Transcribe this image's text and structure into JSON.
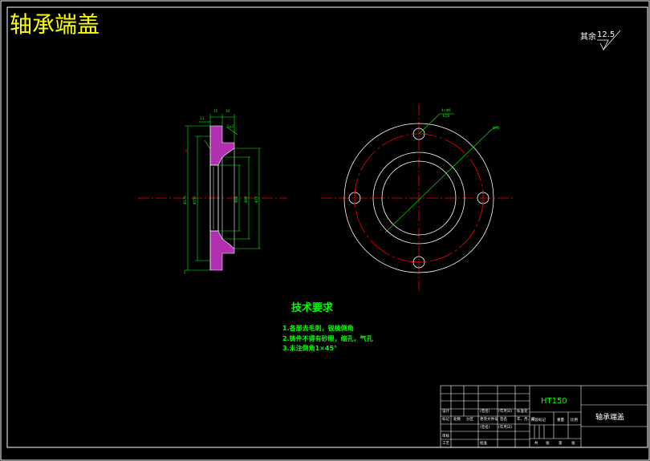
{
  "title": "轴承端盖",
  "roughness_note": {
    "prefix": "其余",
    "value": "12.5"
  },
  "tech_requirements": {
    "heading": "技术要求",
    "items": [
      "1.各部去毛刺，锐棱倒角",
      "2.铸件不得有砂眼，缩孔，气孔",
      "3.未注倒角1×45°"
    ]
  },
  "side_view_dims": {
    "top": [
      "15",
      "10"
    ],
    "left": [
      "13"
    ],
    "chamfer": "5×2",
    "diameters": [
      "Φ176",
      "Φ150",
      "Φ84",
      "Φ99",
      "Φ70"
    ]
  },
  "front_view_dims": {
    "hole_label": [
      "4×Φ9",
      "EQS"
    ],
    "diameter_label": "Φ96"
  },
  "title_block": {
    "material": "HT150",
    "part_name": "轴承端盖",
    "row_labels": [
      "标记",
      "处数",
      "分区",
      "更改文件号",
      "签名",
      "年、月、日"
    ],
    "design_labels": [
      "设计",
      "(签名)",
      "(年月日)",
      "标准化",
      "(签名)",
      "(年月日)"
    ],
    "stage_labels": [
      "阶段标记",
      "重量",
      "比例"
    ],
    "review_label": "审核",
    "process_label": "工艺",
    "approve_label": "批准",
    "sheet_labels": [
      "共",
      "张",
      "第",
      "张"
    ]
  }
}
